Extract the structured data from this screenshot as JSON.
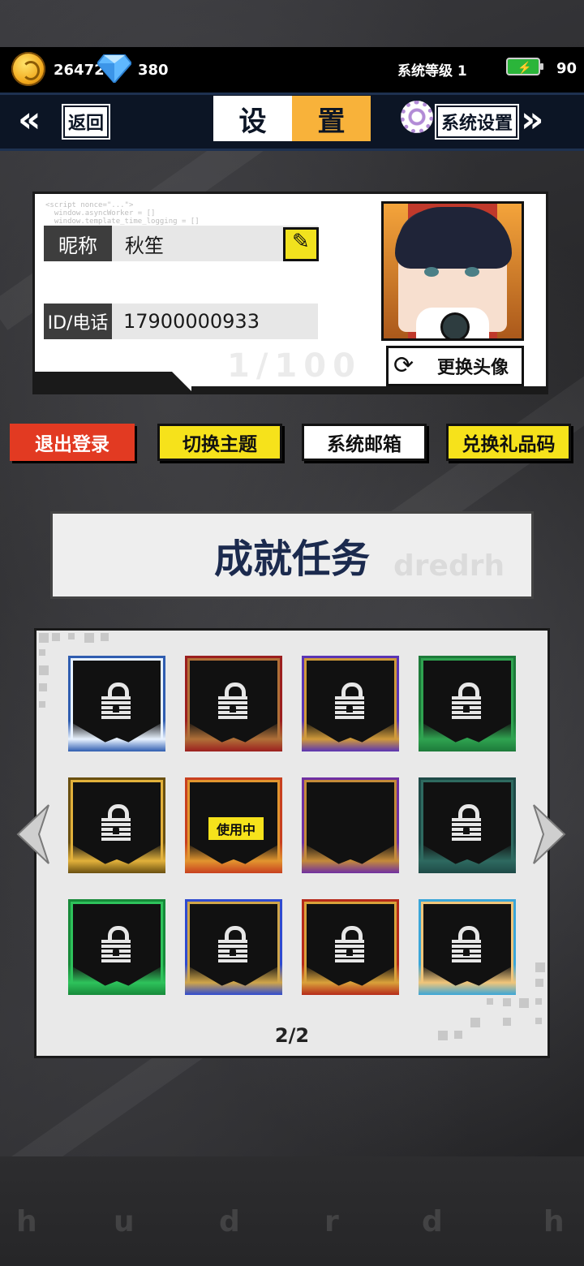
{
  "status": {
    "coins": "26472",
    "diamonds": "380",
    "system_level": "系统等级 1",
    "battery": "90"
  },
  "nav": {
    "back_label": "返回",
    "title_left": "设",
    "title_right": "置",
    "system_settings_label": "系统设置"
  },
  "profile": {
    "nickname_label": "昵称",
    "nickname_value": "秋笙",
    "id_label": "ID/电话",
    "id_value": "17900000933",
    "change_avatar_label": "更换头像"
  },
  "actions": {
    "logout": "退出登录",
    "switch_theme": "切换主题",
    "system_mail": "系统邮箱",
    "redeem_code": "兑换礼品码"
  },
  "achievements": {
    "title": "成就任务",
    "page_indicator": "2/2",
    "frames": [
      {
        "name": "snowflake-frame",
        "locked": true,
        "accent": "#2f5db0",
        "trim": "#e8f2ff"
      },
      {
        "name": "crimson-frame",
        "locked": true,
        "accent": "#9c1f1f",
        "trim": "#b07038"
      },
      {
        "name": "violet-frame",
        "locked": true,
        "accent": "#5a35b5",
        "trim": "#d09a3a"
      },
      {
        "name": "green-tech-frame",
        "locked": true,
        "accent": "#1d7a3a",
        "trim": "#2fa350"
      },
      {
        "name": "gold-gear-frame",
        "locked": true,
        "accent": "#6a5010",
        "trim": "#e2b13b"
      },
      {
        "name": "flame-frame",
        "locked": false,
        "in_use_label": "使用中",
        "accent": "#c8401f",
        "trim": "#e2952f"
      },
      {
        "name": "purple-bolt-frame",
        "locked": false,
        "accent": "#6f2fa2",
        "trim": "#c48a3a"
      },
      {
        "name": "teal-dragon-frame",
        "locked": true,
        "accent": "#1e4a47",
        "trim": "#2e6a60"
      },
      {
        "name": "emerald-frame",
        "locked": true,
        "accent": "#178a3a",
        "trim": "#2ec25b"
      },
      {
        "name": "thunder-frame",
        "locked": true,
        "accent": "#2f4bd0",
        "trim": "#cfa54a"
      },
      {
        "name": "red-gold-frame",
        "locked": true,
        "accent": "#b62a1a",
        "trim": "#d9a13a"
      },
      {
        "name": "ice-wing-frame",
        "locked": true,
        "accent": "#3aa6d8",
        "trim": "#f0c57a"
      }
    ]
  },
  "colors": {
    "accent_yellow": "#f6e21b",
    "accent_red": "#e23a22",
    "nav_bg": "#0c1525",
    "tab_orange": "#f8b23a",
    "title_navy": "#1b2a4e"
  }
}
